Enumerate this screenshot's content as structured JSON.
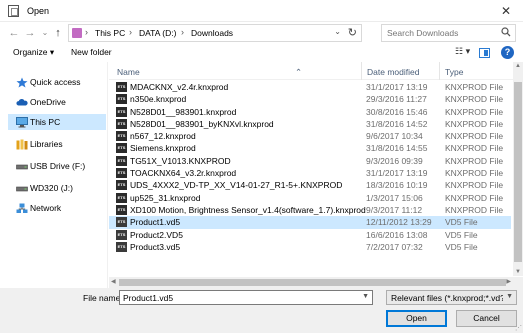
{
  "window": {
    "title": "Open",
    "close": "✕"
  },
  "nav": {
    "back": "←",
    "forward": "→",
    "recent": "⌄",
    "up": "↑"
  },
  "address": {
    "segments": [
      "This PC",
      "DATA (D:)",
      "Downloads"
    ],
    "separator": "›",
    "dropdown": "⌄",
    "refresh": "↻"
  },
  "search": {
    "placeholder": "Search Downloads"
  },
  "toolbar": {
    "organize": "Organize ▾",
    "new_folder": "New folder",
    "view": "☷ ▾",
    "help": "?"
  },
  "sidebar": {
    "items": [
      {
        "label": "Quick access",
        "icon": "star-icon"
      },
      {
        "label": "OneDrive",
        "icon": "cloud-icon"
      },
      {
        "label": "This PC",
        "icon": "computer-icon",
        "selected": true
      },
      {
        "label": "Libraries",
        "icon": "library-icon"
      },
      {
        "label": "USB Drive (F:)",
        "icon": "drive-icon"
      },
      {
        "label": "WD320 (J:)",
        "icon": "drive-icon"
      },
      {
        "label": "Network",
        "icon": "network-icon"
      }
    ]
  },
  "columns": {
    "name": "Name",
    "date": "Date modified",
    "type": "Type"
  },
  "files": [
    {
      "name": "MDACKNX_v2.4r.knxprod",
      "date": "31/1/2017 13:19",
      "type": "KNXPROD File",
      "icon": "knx"
    },
    {
      "name": "n350e.knxprod",
      "date": "29/3/2016 11:27",
      "type": "KNXPROD File",
      "icon": "knx"
    },
    {
      "name": "N528D01__983901.knxprod",
      "date": "30/8/2016 15:46",
      "type": "KNXPROD File",
      "icon": "knx"
    },
    {
      "name": "N528D01__983901_byKNXvl.knxprod",
      "date": "31/8/2016 14:52",
      "type": "KNXPROD File",
      "icon": "knx"
    },
    {
      "name": "n567_12.knxprod",
      "date": "9/6/2017 10:34",
      "type": "KNXPROD File",
      "icon": "knx"
    },
    {
      "name": "Siemens.knxprod",
      "date": "31/8/2016 14:55",
      "type": "KNXPROD File",
      "icon": "knx"
    },
    {
      "name": "TG51X_V1013.KNXPROD",
      "date": "9/3/2016 09:39",
      "type": "KNXPROD File",
      "icon": "knx"
    },
    {
      "name": "TOACKNX64_v3.2r.knxprod",
      "date": "31/1/2017 13:19",
      "type": "KNXPROD File",
      "icon": "knx"
    },
    {
      "name": "UDS_4XXX2_VD-TP_XX_V14-01-27_R1-5+.KNXPROD",
      "date": "18/3/2016 10:19",
      "type": "KNXPROD File",
      "icon": "knx"
    },
    {
      "name": "up525_31.knxprod",
      "date": "1/3/2017 15:06",
      "type": "KNXPROD File",
      "icon": "knx"
    },
    {
      "name": "XD100 Motion, Brightness Sensor_v1.4(software_1.7).knxprod",
      "date": "9/3/2017 11:12",
      "type": "KNXPROD File",
      "icon": "knx"
    },
    {
      "name": "Product1.vd5",
      "date": "12/11/2012 13:29",
      "type": "VD5 File",
      "icon": "vd5",
      "selected": true
    },
    {
      "name": "Product2.VD5",
      "date": "16/6/2016 13:08",
      "type": "VD5 File",
      "icon": "vd5"
    },
    {
      "name": "Product3.vd5",
      "date": "7/2/2017 07:32",
      "type": "VD5 File",
      "icon": "vd5"
    }
  ],
  "bottom": {
    "file_name_label": "File name:",
    "file_name_value": "Product1.vd5",
    "filter": "Relevant files (*.knxprod;*.vd?;*",
    "open": "Open",
    "cancel": "Cancel"
  }
}
